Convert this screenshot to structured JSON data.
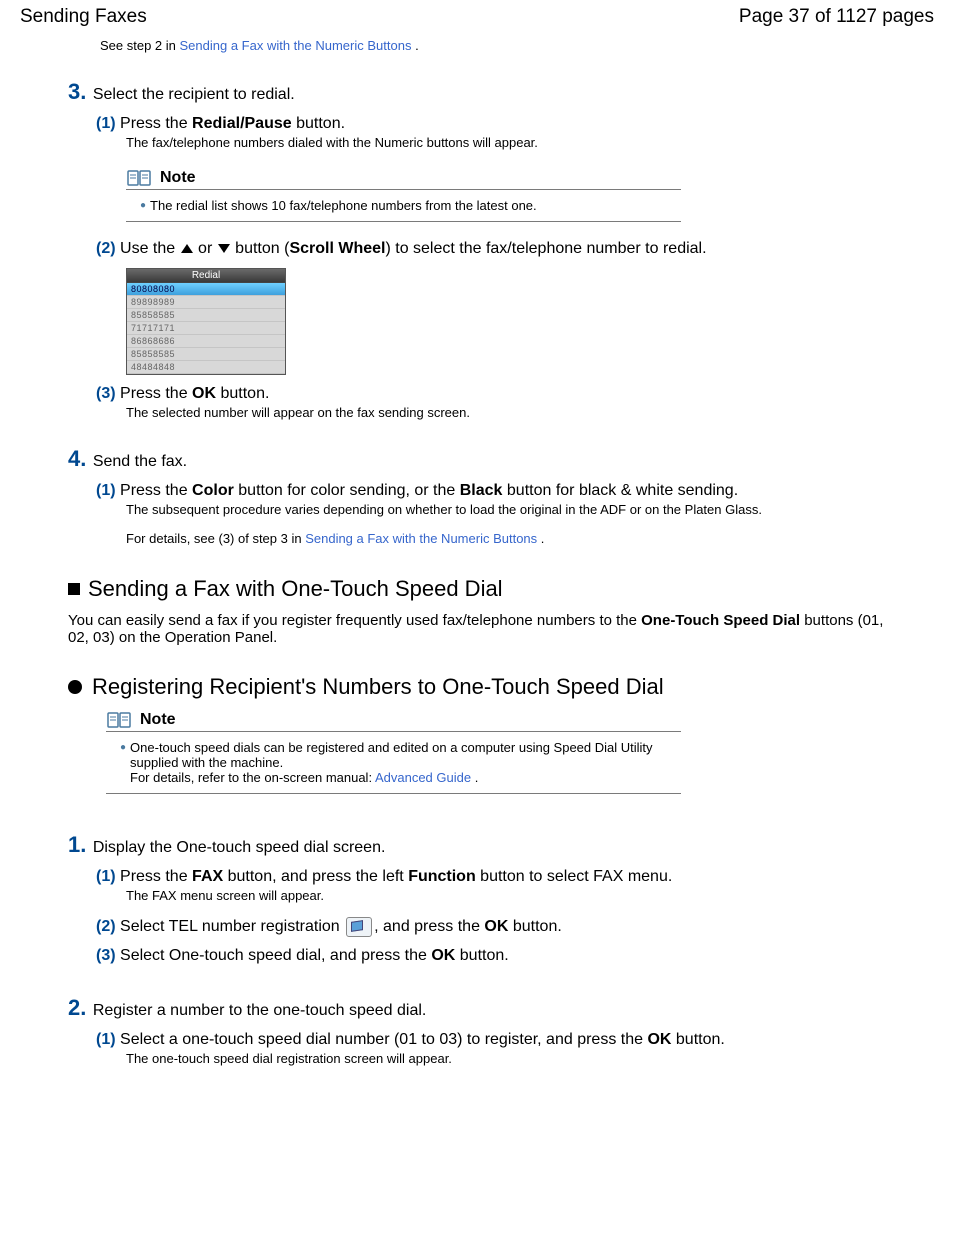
{
  "header": {
    "left": "Sending Faxes",
    "right": "Page 37 of 1127 pages"
  },
  "intro": {
    "prefix": "See step 2 in ",
    "link": "Sending a Fax with the Numeric Buttons",
    "suffix": " ."
  },
  "step3": {
    "num": "3.",
    "title": "Select the recipient to redial.",
    "s1": {
      "num": "(1)",
      "t1": "Press the ",
      "b1": "Redial/Pause",
      "t2": " button.",
      "sub": "The fax/telephone numbers dialed with the Numeric buttons will appear."
    },
    "note": {
      "title": "Note",
      "text": "The redial list shows 10 fax/telephone numbers from the latest one."
    },
    "s2": {
      "num": "(2)",
      "t1": "Use the ",
      "t2": " or ",
      "t3": " button (",
      "b1": "Scroll Wheel",
      "t4": ") to select the fax/telephone number to redial."
    },
    "redial": {
      "title": "Redial",
      "rows": [
        "80808080",
        "89898989",
        "85858585",
        "71717171",
        "86868686",
        "85858585",
        "48484848"
      ]
    },
    "s3": {
      "num": "(3)",
      "t1": "Press the ",
      "b1": "OK",
      "t2": " button.",
      "sub": "The selected number will appear on the fax sending screen."
    }
  },
  "step4": {
    "num": "4.",
    "title": "Send the fax.",
    "s1": {
      "num": "(1)",
      "t1": "Press the ",
      "b1": "Color",
      "t2": " button for color sending, or the ",
      "b2": "Black",
      "t3": " button for black & white sending.",
      "sub": "The subsequent procedure varies depending on whether to load the original in the ADF or on the Platen Glass.",
      "detPrefix": "For details, see (3) of step 3 in ",
      "detLink": "Sending a Fax with the Numeric Buttons",
      "detSuffix": " ."
    }
  },
  "sec2": {
    "h2": "Sending a Fax with One-Touch Speed Dial",
    "p1a": "You can easily send a fax if you register frequently used fax/telephone numbers to the ",
    "p1b": "One-Touch Speed Dial",
    "p1c": " buttons (01, 02, 03) on the Operation Panel.",
    "h3": "Registering Recipient's Numbers to One-Touch Speed Dial",
    "note": {
      "title": "Note",
      "l1": "One-touch speed dials can be registered and edited on a computer using Speed Dial Utility supplied with the machine.",
      "l2a": "For details, refer to the on-screen manual: ",
      "l2link": "Advanced Guide",
      "l2b": " ."
    }
  },
  "r1": {
    "num": "1.",
    "title": "Display the One-touch speed dial screen.",
    "s1": {
      "num": "(1)",
      "t1": "Press the ",
      "b1": "FAX",
      "t2": " button, and press the left ",
      "b2": "Function",
      "t3": " button to select FAX menu.",
      "sub": "The FAX menu screen will appear."
    },
    "s2": {
      "num": "(2)",
      "t1": "Select TEL number registration ",
      "t2": ", and press the ",
      "b1": "OK",
      "t3": " button."
    },
    "s3": {
      "num": "(3)",
      "t1": "Select One-touch speed dial, and press the ",
      "b1": "OK",
      "t2": " button."
    }
  },
  "r2": {
    "num": "2.",
    "title": "Register a number to the one-touch speed dial.",
    "s1": {
      "num": "(1)",
      "t1": "Select a one-touch speed dial number (01 to 03) to register, and press the ",
      "b1": "OK",
      "t2": " button.",
      "sub": "The one-touch speed dial registration screen will appear."
    }
  }
}
